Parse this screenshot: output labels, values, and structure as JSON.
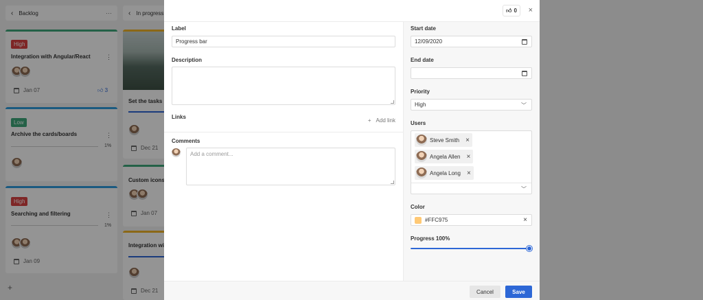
{
  "board": {
    "columns": [
      {
        "title": "Backlog",
        "menu": "···"
      },
      {
        "title": "In progress"
      }
    ],
    "cards": [
      {
        "badge": "High",
        "badge_color": "#d94242",
        "title": "Integration with Angular/React",
        "date": "Jan 07",
        "likes": "3",
        "stripe": "#3ea87a"
      },
      {
        "badge": "Low",
        "badge_color": "#3ea87a",
        "title": "Archive the cards/boards",
        "progress_text": "1%",
        "stripe": "#2e9bdc"
      },
      {
        "badge": "High",
        "badge_color": "#d94242",
        "title": "Searching and filtering",
        "progress_text": "1%",
        "date": "Jan 09",
        "stripe": "#2e9bdc"
      },
      {
        "title": "Set the tasks p",
        "date": "Dec 21",
        "stripe": "#f0b429"
      },
      {
        "title": "Custom icons",
        "date": "Jan 07",
        "stripe": "#3ea87a"
      },
      {
        "title": "Integration wit",
        "date": "Dec 21",
        "stripe": "#f0b429"
      }
    ],
    "add_symbol": "+"
  },
  "modal": {
    "likes": "0",
    "close_symbol": "×",
    "label": {
      "title": "Label",
      "value": "Progress bar"
    },
    "description": {
      "title": "Description",
      "value": ""
    },
    "links": {
      "title": "Links",
      "add_label": "Add link",
      "add_symbol": "+"
    },
    "comments": {
      "title": "Comments",
      "placeholder": "Add a comment..."
    },
    "start_date": {
      "title": "Start date",
      "value": "12/09/2020"
    },
    "end_date": {
      "title": "End date",
      "value": ""
    },
    "priority": {
      "title": "Priority",
      "value": "High"
    },
    "users": {
      "title": "Users",
      "items": [
        {
          "name": "Steve Smith"
        },
        {
          "name": "Angela Allen"
        },
        {
          "name": "Angela Long"
        }
      ]
    },
    "color": {
      "title": "Color",
      "value": "#FFC975",
      "swatch": "#FFC975"
    },
    "progress": {
      "title": "Progress 100%",
      "value": 1.0
    },
    "buttons": {
      "cancel": "Cancel",
      "save": "Save"
    },
    "accent": "#2d67d6"
  }
}
